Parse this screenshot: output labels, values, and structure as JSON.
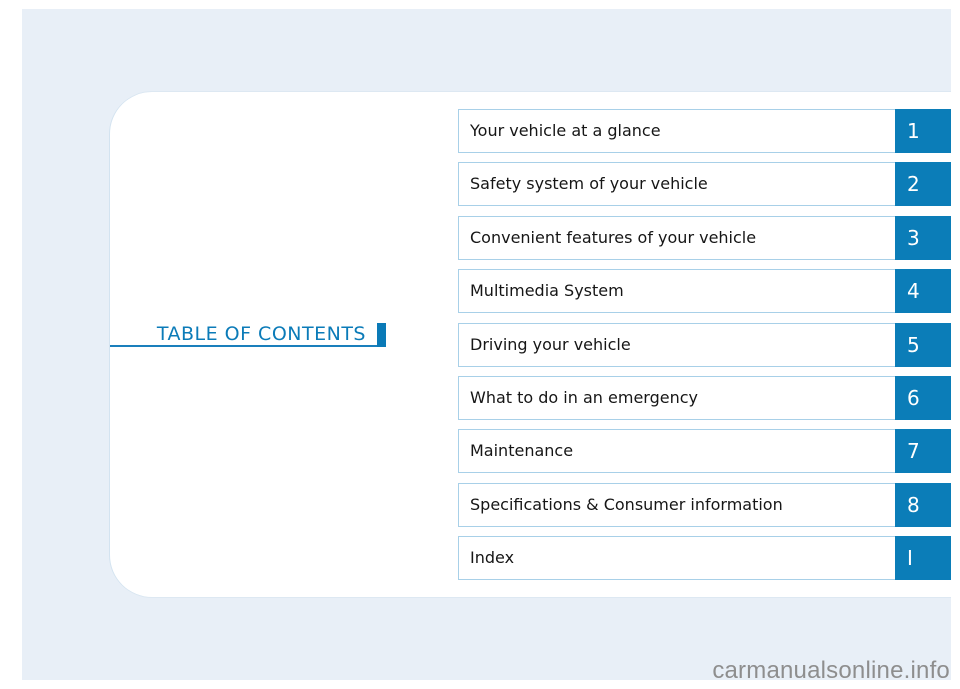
{
  "heading": {
    "title": "TABLE OF CONTENTS"
  },
  "colors": {
    "accent": "#0b7db8",
    "page_background": "#e8eff7",
    "row_border": "#a8d0e8"
  },
  "toc": [
    {
      "label": "Your vehicle at a glance",
      "number": "1"
    },
    {
      "label": "Safety system of your vehicle",
      "number": "2"
    },
    {
      "label": "Convenient features of your vehicle",
      "number": "3"
    },
    {
      "label": "Multimedia System",
      "number": "4"
    },
    {
      "label": "Driving your vehicle",
      "number": "5"
    },
    {
      "label": "What to do in an emergency",
      "number": "6"
    },
    {
      "label": "Maintenance",
      "number": "7"
    },
    {
      "label": "Specifications & Consumer information",
      "number": "8"
    },
    {
      "label": "Index",
      "number": "I"
    }
  ],
  "watermark": "carmanualsonline.info"
}
